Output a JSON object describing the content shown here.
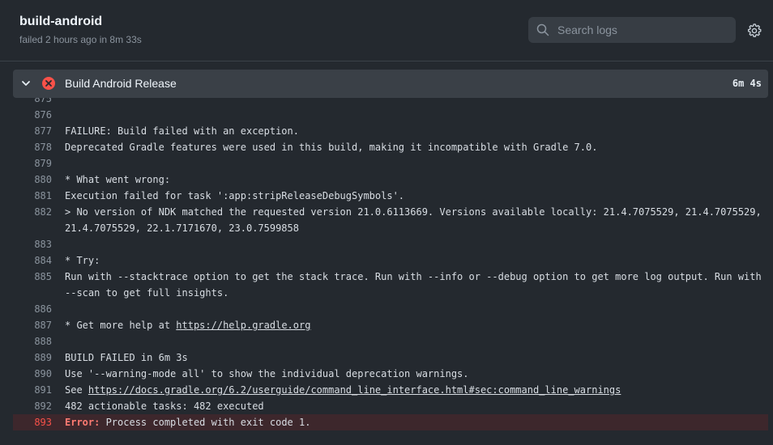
{
  "job": {
    "name": "build-android",
    "status_line": "failed 2 hours ago in 8m 33s"
  },
  "search": {
    "placeholder": "Search logs"
  },
  "step": {
    "title": "Build Android Release",
    "duration": "6m 4s"
  },
  "colors": {
    "error": "#f85149",
    "background": "#24292f",
    "step_header": "#3a4047"
  },
  "icons": [
    "search-icon",
    "gear-icon",
    "chevron-down-icon",
    "failed-icon"
  ],
  "log_lines": [
    {
      "n": "875",
      "t": ""
    },
    {
      "n": "876",
      "t": ""
    },
    {
      "n": "877",
      "t": "FAILURE: Build failed with an exception."
    },
    {
      "n": "878",
      "t": "Deprecated Gradle features were used in this build, making it incompatible with Gradle 7.0."
    },
    {
      "n": "879",
      "t": ""
    },
    {
      "n": "880",
      "t": "* What went wrong:"
    },
    {
      "n": "881",
      "t": "Execution failed for task ':app:stripReleaseDebugSymbols'."
    },
    {
      "n": "882",
      "t": "> No version of NDK matched the requested version 21.0.6113669. Versions available locally: 21.4.7075529, 21.4.7075529, 21.4.7075529, 22.1.7171670, 23.0.7599858"
    },
    {
      "n": "883",
      "t": ""
    },
    {
      "n": "884",
      "t": "* Try:"
    },
    {
      "n": "885",
      "t": "Run with --stacktrace option to get the stack trace. Run with --info or --debug option to get more log output. Run with --scan to get full insights."
    },
    {
      "n": "886",
      "t": ""
    },
    {
      "n": "887",
      "t": "* Get more help at ",
      "link": "https://help.gradle.org"
    },
    {
      "n": "888",
      "t": ""
    },
    {
      "n": "889",
      "t": "BUILD FAILED in 6m 3s"
    },
    {
      "n": "890",
      "t": "Use '--warning-mode all' to show the individual deprecation warnings."
    },
    {
      "n": "891",
      "t": "See ",
      "link": "https://docs.gradle.org/6.2/userguide/command_line_interface.html#sec:command_line_warnings"
    },
    {
      "n": "892",
      "t": "482 actionable tasks: 482 executed"
    },
    {
      "n": "893",
      "t": " Process completed with exit code 1.",
      "error_prefix": "Error:",
      "error": true
    }
  ]
}
